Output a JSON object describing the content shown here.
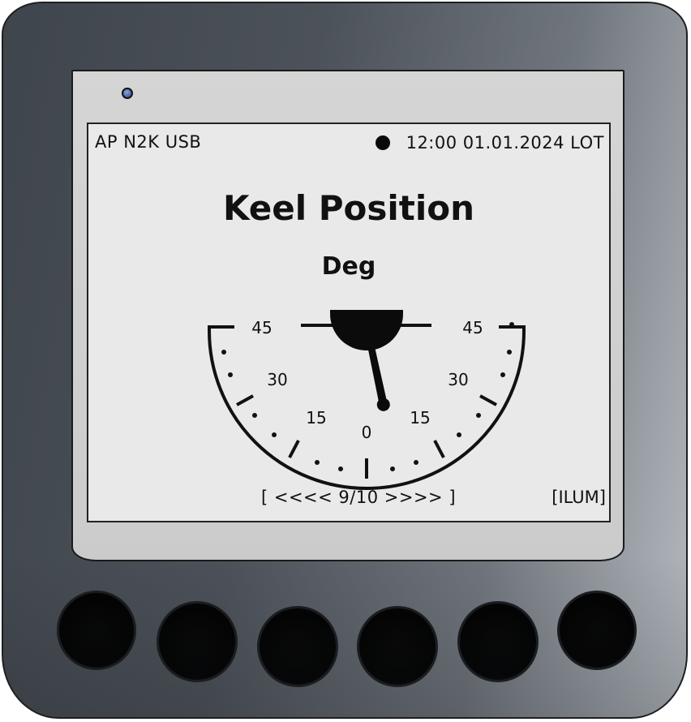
{
  "status": {
    "left": "AP N2K USB",
    "right": "12:00 01.01.2024 LOT"
  },
  "page": {
    "title": "Keel Position",
    "unit": "Deg"
  },
  "gauge": {
    "value_deg": -12,
    "min_deg": -45,
    "max_deg": 45,
    "labels": {
      "left_45": "45",
      "right_45": "45",
      "left_30": "30",
      "right_30": "30",
      "left_15": "15",
      "right_15": "15",
      "zero": "0"
    }
  },
  "footer": {
    "pager": "[ <<<< 9/10 >>>> ]",
    "ilum": "[ILUM]"
  },
  "colors": {
    "led": "#4862a8",
    "screen": "#e9e9e9",
    "ink": "#111111",
    "case": "#4c5259"
  }
}
